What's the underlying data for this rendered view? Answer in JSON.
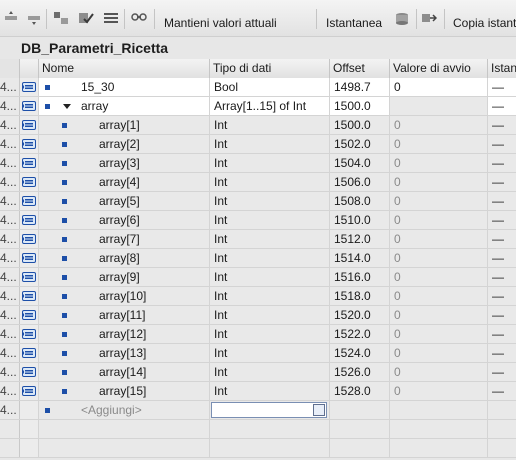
{
  "toolbar": {
    "keep_values_label": "Mantieni valori attuali",
    "snapshot_label": "Istantanea",
    "copy_snapshot_label": "Copia istant"
  },
  "block": {
    "title": "DB_Parametri_Ricetta"
  },
  "columns": {
    "name": "Nome",
    "type": "Tipo di dati",
    "offset": "Offset",
    "start_value": "Valore di avvio",
    "retain": "Istan"
  },
  "row_index_text": "4...",
  "rows": [
    {
      "name": "15_30",
      "type": "Bool",
      "offset": "1498.7",
      "start": "0",
      "retain": "—"
    },
    {
      "name": "array",
      "type": "Array[1..15] of Int",
      "offset": "1500.0",
      "start": "",
      "retain": "—"
    },
    {
      "name": "array[1]",
      "type": "Int",
      "offset": "1500.0",
      "start": "0",
      "retain": "—"
    },
    {
      "name": "array[2]",
      "type": "Int",
      "offset": "1502.0",
      "start": "0",
      "retain": "—"
    },
    {
      "name": "array[3]",
      "type": "Int",
      "offset": "1504.0",
      "start": "0",
      "retain": "—"
    },
    {
      "name": "array[4]",
      "type": "Int",
      "offset": "1506.0",
      "start": "0",
      "retain": "—"
    },
    {
      "name": "array[5]",
      "type": "Int",
      "offset": "1508.0",
      "start": "0",
      "retain": "—"
    },
    {
      "name": "array[6]",
      "type": "Int",
      "offset": "1510.0",
      "start": "0",
      "retain": "—"
    },
    {
      "name": "array[7]",
      "type": "Int",
      "offset": "1512.0",
      "start": "0",
      "retain": "—"
    },
    {
      "name": "array[8]",
      "type": "Int",
      "offset": "1514.0",
      "start": "0",
      "retain": "—"
    },
    {
      "name": "array[9]",
      "type": "Int",
      "offset": "1516.0",
      "start": "0",
      "retain": "—"
    },
    {
      "name": "array[10]",
      "type": "Int",
      "offset": "1518.0",
      "start": "0",
      "retain": "—"
    },
    {
      "name": "array[11]",
      "type": "Int",
      "offset": "1520.0",
      "start": "0",
      "retain": "—"
    },
    {
      "name": "array[12]",
      "type": "Int",
      "offset": "1522.0",
      "start": "0",
      "retain": "—"
    },
    {
      "name": "array[13]",
      "type": "Int",
      "offset": "1524.0",
      "start": "0",
      "retain": "—"
    },
    {
      "name": "array[14]",
      "type": "Int",
      "offset": "1526.0",
      "start": "0",
      "retain": "—"
    },
    {
      "name": "array[15]",
      "type": "Int",
      "offset": "1528.0",
      "start": "0",
      "retain": "—"
    }
  ],
  "add_row": {
    "label": "<Aggiungi>"
  },
  "colors": {
    "accent": "#1d4fa8",
    "row_alt": "#e9e9e9"
  }
}
